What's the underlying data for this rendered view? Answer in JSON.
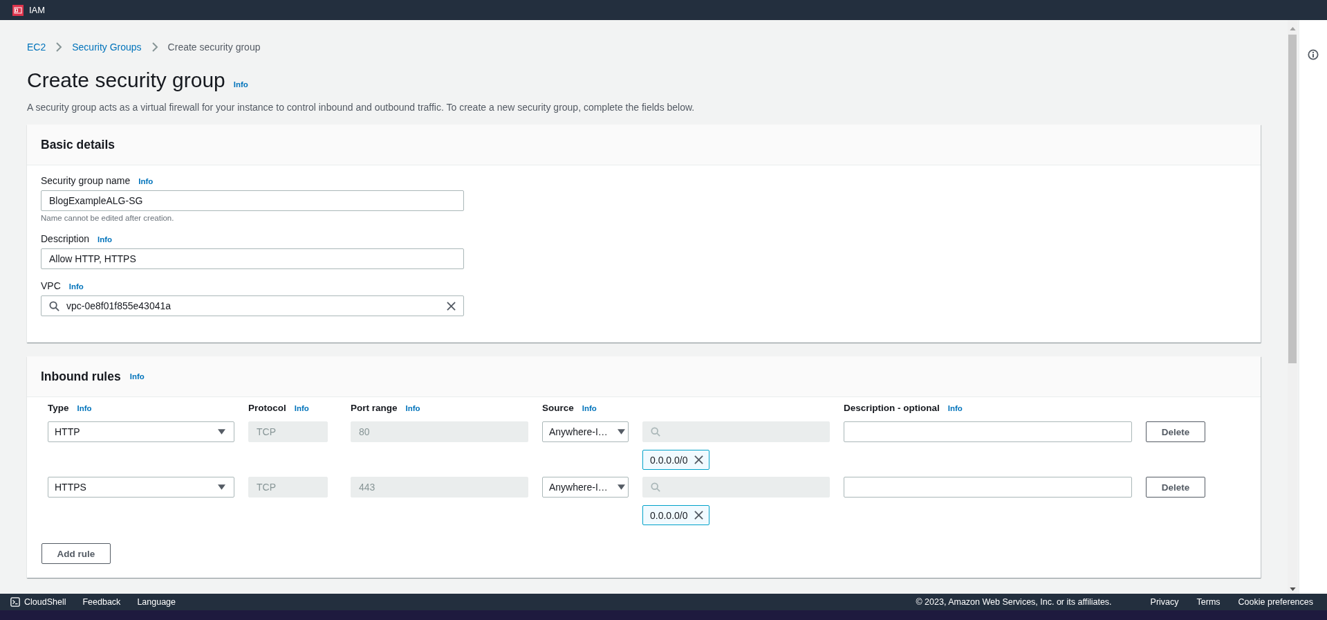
{
  "top_bar": {
    "service": "IAM"
  },
  "breadcrumbs": [
    {
      "label": "EC2",
      "link": true
    },
    {
      "label": "Security Groups",
      "link": true
    },
    {
      "label": "Create security group",
      "link": false
    }
  ],
  "title": "Create security group",
  "title_info": "Info",
  "description": "A security group acts as a virtual firewall for your instance to control inbound and outbound traffic. To create a new security group, complete the fields below.",
  "basic_details": {
    "title": "Basic details",
    "fields": [
      {
        "kind": "text",
        "label": "Security group name",
        "info": "Info",
        "value": "BlogExampleALG-SG",
        "hint": "Name cannot be edited after creation."
      },
      {
        "kind": "text",
        "label": "Description",
        "info": "Info",
        "value": "Allow HTTP, HTTPS"
      },
      {
        "kind": "search",
        "label": "VPC",
        "info": "Info",
        "value": "vpc-0e8f01f855e43041a"
      }
    ]
  },
  "inbound_rules": {
    "title": "Inbound rules",
    "info": "Info",
    "columns": [
      {
        "label": "Type",
        "info": "Info"
      },
      {
        "label": "Protocol",
        "info": "Info"
      },
      {
        "label": "Port range",
        "info": "Info"
      },
      {
        "label": "Source",
        "info": "Info"
      },
      {
        "label": "Description - optional",
        "info": "Info"
      }
    ],
    "rules": [
      {
        "type": "HTTP",
        "protocol": "TCP",
        "port_range": "80",
        "source": "Anywhere-I…",
        "source_tag": "0.0.0.0/0",
        "delete": "Delete"
      },
      {
        "type": "HTTPS",
        "protocol": "TCP",
        "port_range": "443",
        "source": "Anywhere-I…",
        "source_tag": "0.0.0.0/0",
        "delete": "Delete"
      }
    ],
    "add_button": "Add rule"
  },
  "footer": {
    "cloudshell": "CloudShell",
    "left": [
      "Feedback",
      "Language"
    ],
    "copyright": "© 2023, Amazon Web Services, Inc. or its affiliates.",
    "links": [
      "Privacy",
      "Terms",
      "Cookie preferences"
    ]
  }
}
